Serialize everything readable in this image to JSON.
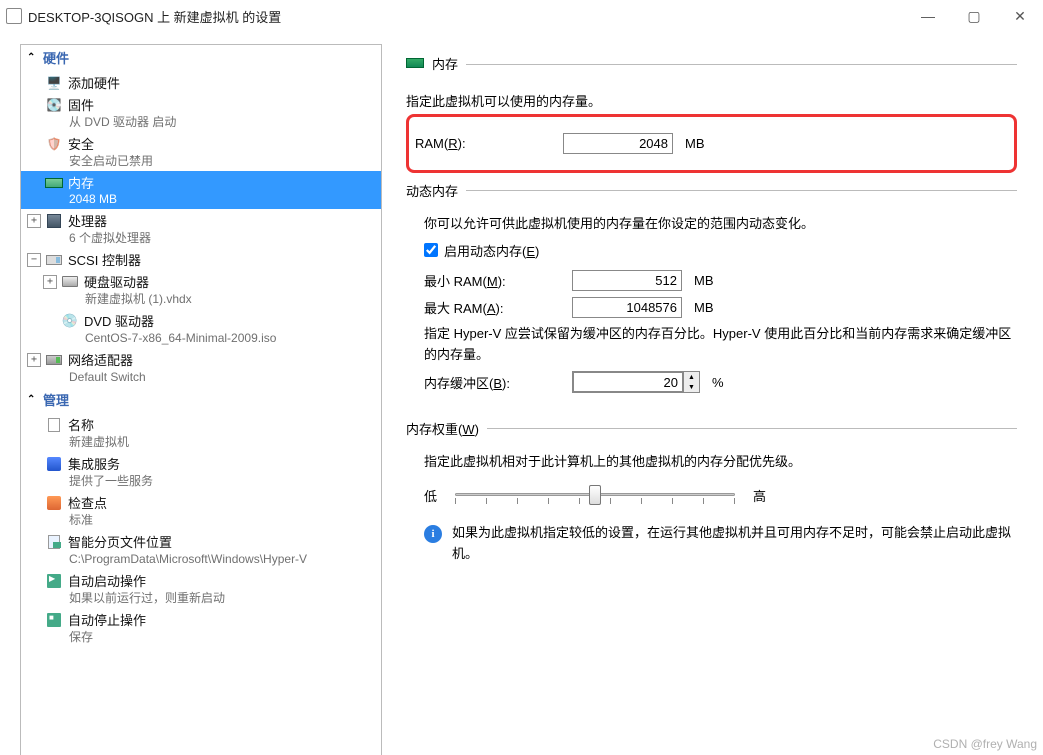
{
  "window": {
    "title": "DESKTOP-3QISOGN 上 新建虚拟机 的设置",
    "min": "—",
    "max": "▢",
    "close": "✕"
  },
  "sidebar": {
    "hw_header": "硬件",
    "mgmt_header": "管理",
    "add_hw": "添加硬件",
    "firmware": "固件",
    "firmware_sub": "从 DVD 驱动器 启动",
    "security": "安全",
    "security_sub": "安全启动已禁用",
    "memory": "内存",
    "memory_sub": "2048 MB",
    "cpu": "处理器",
    "cpu_sub": "6 个虚拟处理器",
    "scsi": "SCSI 控制器",
    "hdd": "硬盘驱动器",
    "hdd_sub": "新建虚拟机 (1).vhdx",
    "dvd": "DVD 驱动器",
    "dvd_sub": "CentOS-7-x86_64-Minimal-2009.iso",
    "net": "网络适配器",
    "net_sub": "Default Switch",
    "name": "名称",
    "name_sub": "新建虚拟机",
    "svc": "集成服务",
    "svc_sub": "提供了一些服务",
    "chk": "检查点",
    "chk_sub": "标准",
    "page": "智能分页文件位置",
    "page_sub": "C:\\ProgramData\\Microsoft\\Windows\\Hyper-V",
    "start": "自动启动操作",
    "start_sub": "如果以前运行过，则重新启动",
    "stop": "自动停止操作",
    "stop_sub": "保存"
  },
  "pane": {
    "title": "内存",
    "desc": "指定此虚拟机可以使用的内存量。",
    "ram_label_pre": "RAM(",
    "ram_accel": "R",
    "ram_label_post": "):",
    "ram_value": "2048",
    "mb": "MB",
    "dyn_title": "动态内存",
    "dyn_desc": "你可以允许可供此虚拟机使用的内存量在你设定的范围内动态变化。",
    "dyn_cb_pre": "启用动态内存(",
    "dyn_cb_accel": "E",
    "dyn_cb_post": ")",
    "min_label_pre": "最小 RAM(",
    "min_accel": "M",
    "min_label_post": "):",
    "min_value": "512",
    "max_label_pre": "最大 RAM(",
    "max_accel": "A",
    "max_label_post": "):",
    "max_value": "1048576",
    "buf_desc": "指定 Hyper-V 应尝试保留为缓冲区的内存百分比。Hyper-V 使用此百分比和当前内存需求来确定缓冲区的内存量。",
    "buf_label_pre": "内存缓冲区(",
    "buf_accel": "B",
    "buf_label_post": "):",
    "buf_value": "20",
    "pct": "%",
    "weight_title_pre": "内存权重(",
    "weight_accel": "W",
    "weight_title_post": ")",
    "weight_desc": "指定此虚拟机相对于此计算机上的其他虚拟机的内存分配优先级。",
    "low": "低",
    "high": "高",
    "info": "如果为此虚拟机指定较低的设置，在运行其他虚拟机并且可用内存不足时，可能会禁止启动此虚拟机。"
  },
  "watermark": "CSDN @frey Wang"
}
